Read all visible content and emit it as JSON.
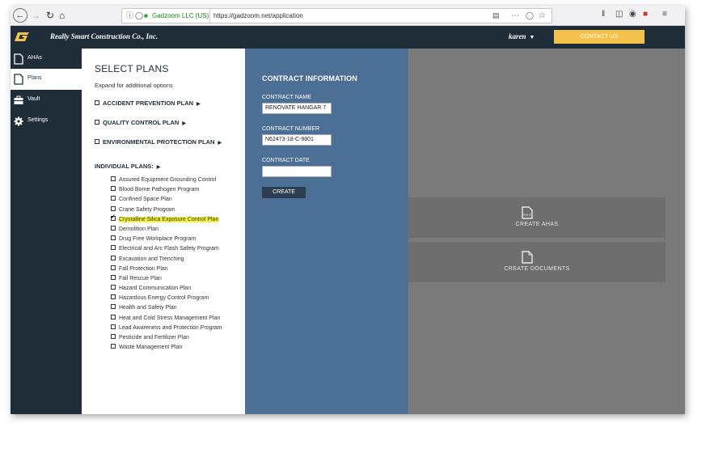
{
  "browser": {
    "site_identity": "Gadzoom LLC (US)",
    "url": "https://gadzoom.net/application"
  },
  "header": {
    "company": "Really Smart Construction Co., Inc.",
    "user": "karen",
    "contact_button": "CONTACT US"
  },
  "sidebar": {
    "items": [
      {
        "label": "AHAs",
        "icon": "document-icon",
        "active": false
      },
      {
        "label": "Plans",
        "icon": "document-icon",
        "active": true
      },
      {
        "label": "Vault",
        "icon": "briefcase-icon",
        "active": false
      },
      {
        "label": "Settings",
        "icon": "gear-icon",
        "active": false
      }
    ]
  },
  "plans": {
    "title": "SELECT PLANS",
    "subtitle": "Expand for additional options",
    "groups": [
      "ACCIDENT PREVENTION PLAN",
      "QUALITY CONTROL PLAN",
      "ENVIRONMENTAL PROTECTION PLAN"
    ],
    "individual_title": "INDIVIDUAL PLANS:",
    "individual": [
      {
        "label": "Assured Equipment Grounding Control",
        "checked": false
      },
      {
        "label": "Blood Borne Pathogen Program",
        "checked": false
      },
      {
        "label": "Confined Space Plan",
        "checked": false
      },
      {
        "label": "Crane Safety Program",
        "checked": false
      },
      {
        "label": "Crystalline Silica Exposure Control Plan",
        "checked": true
      },
      {
        "label": "Demolition Plan",
        "checked": false
      },
      {
        "label": "Drug Free Workplace Program",
        "checked": false
      },
      {
        "label": "Electrical and Arc Flash Safety Program",
        "checked": false
      },
      {
        "label": "Excavation and Trenching",
        "checked": false
      },
      {
        "label": "Fall Protection Plan",
        "checked": false
      },
      {
        "label": "Fall Rescue Plan",
        "checked": false
      },
      {
        "label": "Hazard Communication Plan",
        "checked": false
      },
      {
        "label": "Hazardous Energy Control Program",
        "checked": false
      },
      {
        "label": "Health and Safety Plan",
        "checked": false
      },
      {
        "label": "Heat and Cold Stress Management Plan",
        "checked": false
      },
      {
        "label": "Lead Awareness and Protection Program",
        "checked": false
      },
      {
        "label": "Pesticide and Fertilizer Plan",
        "checked": false
      },
      {
        "label": "Waste Management Plan",
        "checked": false
      }
    ]
  },
  "contract": {
    "title": "CONTRACT INFORMATION",
    "name_label": "CONTRACT NAME",
    "name_value": "RENOVATE HANGAR 7",
    "number_label": "CONTRACT NUMBER",
    "number_value": "N62473-18-C-9801",
    "date_label": "CONTRACT DATE",
    "date_value": "",
    "create_button": "CREATE"
  },
  "actions": {
    "create_ahas": "CREATE AHAS",
    "ahas_icon_text": "AHA",
    "create_documents": "CREATE DOCUMENTS"
  },
  "colors": {
    "header_bg": "#1f2d38",
    "contract_bg": "#4b6f95",
    "accent": "#f3c24a",
    "highlight": "#f6f33a"
  }
}
